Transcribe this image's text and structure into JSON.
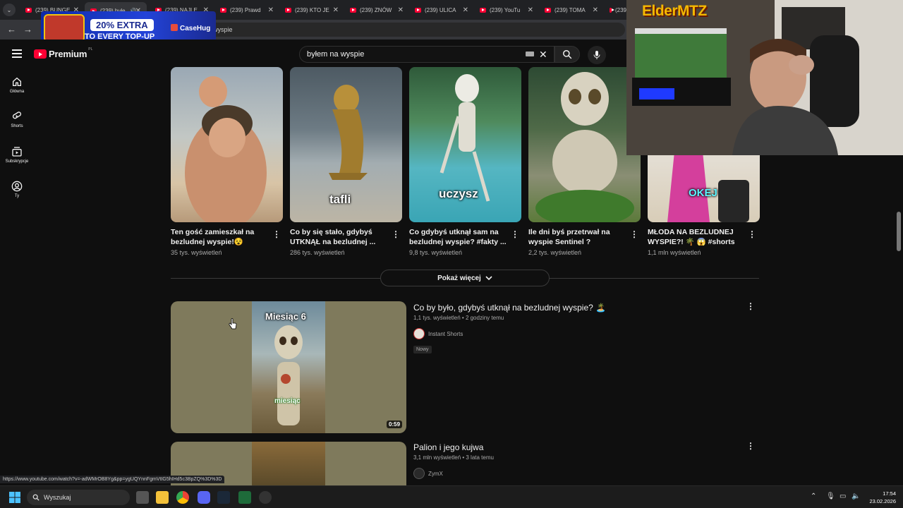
{
  "browser": {
    "tabs": [
      {
        "label": "(239) BUNGE",
        "active": false
      },
      {
        "label": "(239) byłe",
        "active": true
      },
      {
        "label": "(239) NAJLE",
        "active": false
      },
      {
        "label": "(239) Prawd",
        "active": false
      },
      {
        "label": "(239) KTO JE",
        "active": false
      },
      {
        "label": "(239) ZNÓW",
        "active": false
      },
      {
        "label": "(239) ULICA",
        "active": false
      },
      {
        "label": "(239) YouTu",
        "active": false
      },
      {
        "label": "(239) TOMA",
        "active": false
      },
      {
        "label": "(239",
        "active": false
      }
    ],
    "address_partial": "wyspie",
    "status_url": "https://www.youtube.com/watch?v=-adWMrOB8Yg&pp=ygUQYnnFgmVtIG5hIHd5c3BpZQ%3D%3D"
  },
  "promo": {
    "badge": "20% EXTRA",
    "subtitle": "TO EVERY TOP-UP",
    "brand": "CaseHug"
  },
  "youtube": {
    "logo_text": "Premium",
    "country_code": "PL",
    "search_query": "byłem na wyspie"
  },
  "sidebar": [
    {
      "label": "Główna",
      "icon": "home-icon"
    },
    {
      "label": "Shorts",
      "icon": "shorts-icon"
    },
    {
      "label": "Subskrypcje",
      "icon": "subscriptions-icon"
    },
    {
      "label": "Ty",
      "icon": "you-icon"
    }
  ],
  "shorts": [
    {
      "title": "Ten gość zamieszkał na bezludnej wyspie!😵",
      "views": "35 tys. wyświetleń",
      "caption": ""
    },
    {
      "title": "Co by się stało, gdybyś UTKNĄŁ na bezludnej ...",
      "views": "286 tys. wyświetleń",
      "caption": "tafli"
    },
    {
      "title": "Co gdybyś utknął sam na bezludnej wyspie? #fakty ...",
      "views": "9,8 tys. wyświetleń",
      "caption": "uczysz"
    },
    {
      "title": "Ile dni byś przetrwał na wyspie Sentinel ?",
      "views": "2,2 tys. wyświetleń",
      "caption": ""
    },
    {
      "title": "MŁODA NA BEZLUDNEJ WYSPIE?! 🌴 😱 #shorts",
      "views": "1,1 mln wyświetleń",
      "caption": "OKEJ"
    }
  ],
  "show_more_label": "Pokaż więcej",
  "videos": [
    {
      "title": "Co by było, gdybyś utknął na bezludnej wyspie? 🏝️",
      "meta": "1,1 tys. wyświetleń • 2 godziny temu",
      "channel": "Instant Shorts",
      "badge": "Nowy",
      "duration": "0:59",
      "overlay_top": "Miesiąc 6",
      "overlay_bottom": "miesiąc"
    },
    {
      "title": "Palion i jego kujwa",
      "meta": "3,1 mln wyświetleń • 3 lata temu",
      "channel": "ZymX"
    }
  ],
  "webcam": {
    "logo_text": "ElderMTZ"
  },
  "taskbar": {
    "search_placeholder": "Wyszukaj",
    "time": "17:54",
    "date": "23.02.2026"
  },
  "colors": {
    "yt_red": "#ff0033",
    "background": "#0f0f0f",
    "promo_blue": "#2343d8"
  }
}
